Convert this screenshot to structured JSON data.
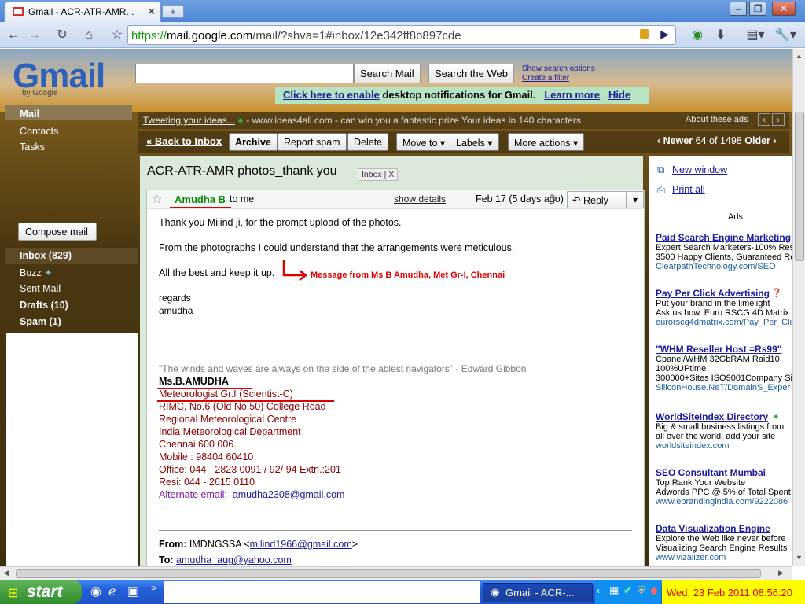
{
  "browser": {
    "tab_title": "Gmail - ACR-ATR-AMR...",
    "url_scheme": "https://",
    "url_host": "mail.google.com",
    "url_path": "/mail/?shva=1#inbox/12e342ff8b897cde"
  },
  "header": {
    "logo": "Gmail",
    "logo_sub": "by Google",
    "search_mail": "Search Mail",
    "search_web": "Search the Web",
    "show_search_options": "Show search options",
    "create_filter": "Create a filter"
  },
  "notification": {
    "enable_link": "Click here to enable",
    "text": "desktop notifications for Gmail.",
    "learn_more": "Learn more",
    "hide": "Hide"
  },
  "nav": {
    "mail": "Mail",
    "contacts": "Contacts",
    "tasks": "Tasks",
    "compose": "Compose mail",
    "inbox": "Inbox (829)",
    "buzz": "Buzz",
    "sent": "Sent Mail",
    "drafts": "Drafts (10)",
    "spam": "Spam (1)"
  },
  "ad_top": {
    "link": "Tweeting your ideas...",
    "text": "- www.ideas4all.com - can win you a fantastic prize Your ideas in 140 characters",
    "about": "About these ads"
  },
  "actions": {
    "back": "« Back to Inbox",
    "archive": "Archive",
    "report_spam": "Report spam",
    "delete": "Delete",
    "move_to": "Move to ▾",
    "labels": "Labels ▾",
    "more_actions": "More actions ▾",
    "newer": "‹ Newer",
    "position": "64",
    "of": "of",
    "total": "1498",
    "older": "Older ›"
  },
  "message": {
    "subject": "ACR-ATR-AMR photos_thank you",
    "tag": "Inbox",
    "tag_x": "X",
    "sender": "Amudha B",
    "to": "to me",
    "show_details": "show details",
    "date": "Feb 17 (5 days ago)",
    "reply": "Reply",
    "line1": "Thank you Milind ji, for the prompt upload of the photos.",
    "line2": "From the photographs I could understand that the arrangements were meticulous.",
    "line3": "All the best and keep it up.",
    "annotation": "Message from Ms B Amudha, Met Gr-I, Chennai",
    "regards": "regards",
    "name_small": "amudha",
    "quote": "\"The winds and waves are always on the side of the ablest navigators\" - Edward Gibbon",
    "sig_name": "Ms.B.AMUDHA",
    "sig_lines": [
      "Meteorologist Gr.I (Scientist-C)",
      "RIMC, No.6 (Old No.50) College Road",
      "Regional Meteorological Centre",
      "India Meteorological Department",
      "Chennai 600 006.",
      "Mobile : 98404 60410",
      "Office:  044 - 2823 0091 / 92/ 94  Extn.:201",
      "Resi: 044 - 2615 0110"
    ],
    "alt_email_label": "Alternate email:",
    "alt_email": "amudha2308@gmail.com",
    "from_label": "From:",
    "from_name": "IMDNGSSA <",
    "from_email": "milind1966@gmail.com",
    "from_close": ">",
    "to_label": "To:",
    "to_email": "amudha_aug@yahoo.com"
  },
  "right": {
    "new_window": "New window",
    "print_all": "Print all",
    "ads_label": "Ads",
    "ads": [
      {
        "title": "Paid Search Engine Marketing",
        "l1": "Expert Search Marketers-100% Res",
        "l2": "3500 Happy Clients, Guaranteed Re",
        "url": "ClearpathTechnology.com/SEO"
      },
      {
        "title": "Pay Per Click Advertising",
        "l1": "Put your brand in the limelight",
        "l2": "Ask us how. Euro RSCG 4D Matrix",
        "url": "eurorscg4dmatrix.com/Pay_Per_Clic"
      },
      {
        "title": "\"WHM Reseller Host =Rs99\"",
        "l1": "Cpanel/WHM 32GbRAM Raid10",
        "l2": "100%UPtime",
        "l3": "300000+Sites ISO9001Company Sir",
        "url": "SiliconHouse.NeT/DomainS_Exper"
      },
      {
        "title": "WorldSiteIndex Directory",
        "l1": "Big & small business listings from",
        "l2": "all over the world, add your site",
        "url": "worldsiteindex.com"
      },
      {
        "title": "SEO Consultant Mumbai",
        "l1": "Top Rank Your Website",
        "l2": "Adwords PPC @ 5% of Total Spent",
        "url": "www.ebrandingindia.com/9222086"
      },
      {
        "title": "Data Visualization Engine",
        "l1": "Explore the Web like never before",
        "l2": "Visualizing Search Engine Results",
        "url": "www.vizalizer.com"
      }
    ]
  },
  "taskbar": {
    "start": "start",
    "item": "Gmail - ACR-...",
    "clock": "Wed, 23 Feb 2011  08:56:20"
  },
  "colors": {
    "accent_green": "#089a08",
    "link": "#1a1a9c",
    "signature": "#8b0000",
    "annotation": "#dd0000",
    "clock_bg": "#ffff00"
  }
}
